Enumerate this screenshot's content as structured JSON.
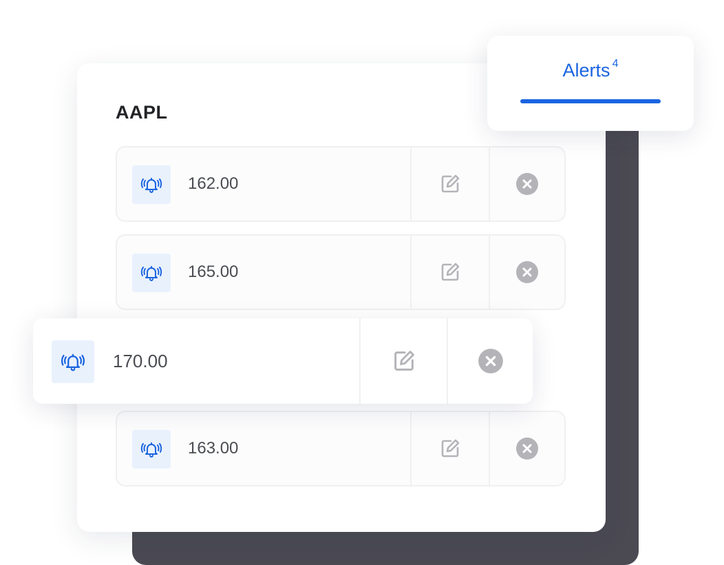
{
  "ticker": "AAPL",
  "tab": {
    "label": "Alerts",
    "count": "4"
  },
  "alerts": [
    {
      "price": "162.00"
    },
    {
      "price": "165.00"
    },
    {
      "price": "170.00"
    },
    {
      "price": "163.00"
    }
  ],
  "icons": {
    "alert": "bell-ringing-icon",
    "edit": "edit-icon",
    "delete": "close-circle-icon"
  },
  "colors": {
    "accent": "#1a64e0",
    "icon_bg": "#e9f1fd",
    "muted_icon": "#b4b4b8",
    "dark_panel": "#4b4a53"
  }
}
